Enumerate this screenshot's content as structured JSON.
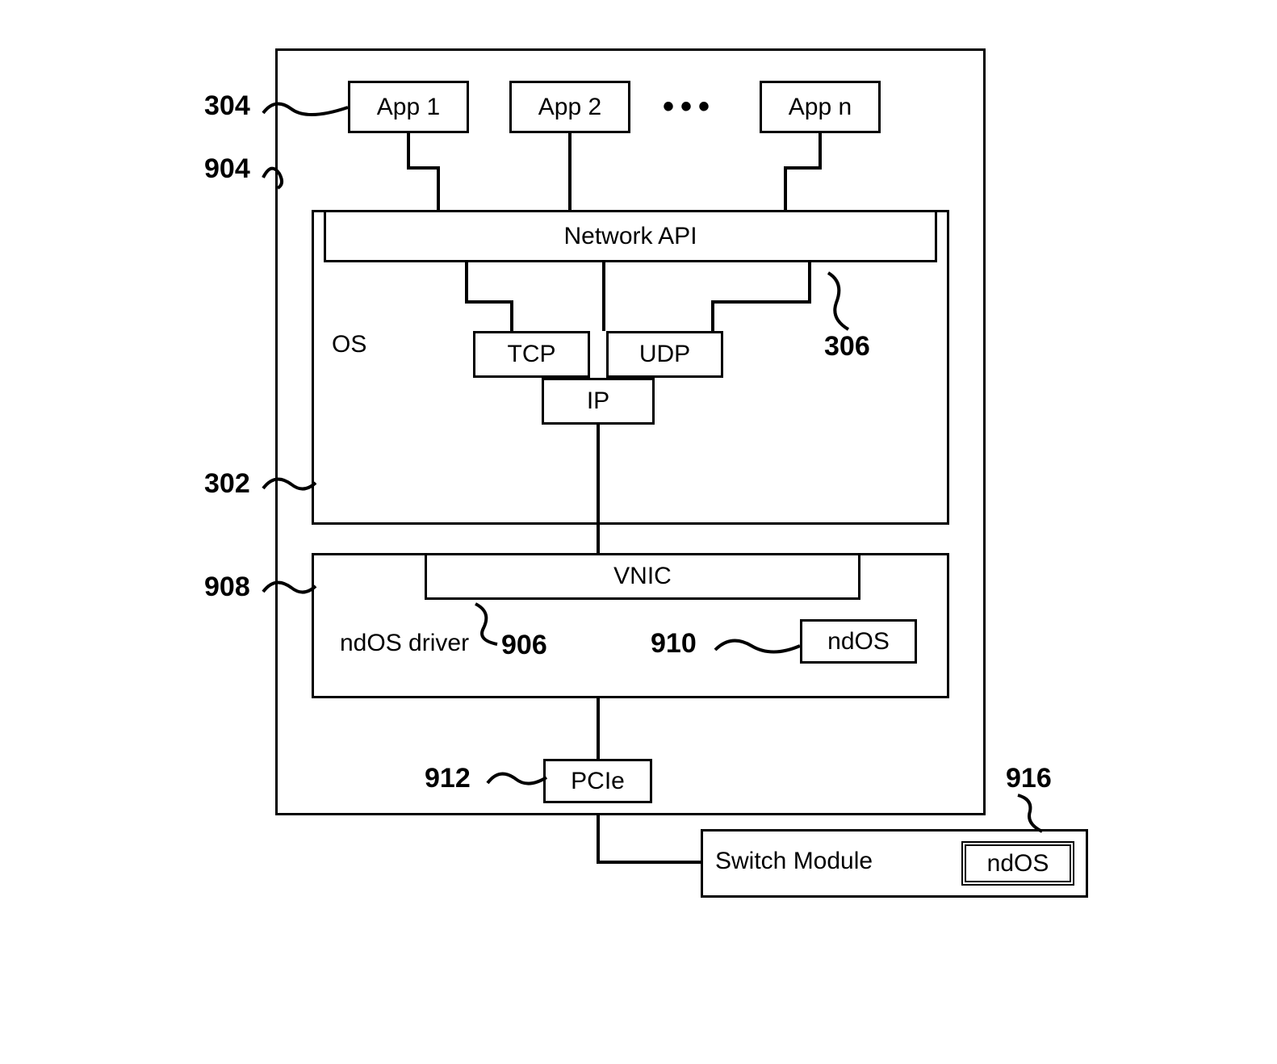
{
  "labels": {
    "l304": "304",
    "l904": "904",
    "l302": "302",
    "l908": "908",
    "l306": "306",
    "l906": "906",
    "l910": "910",
    "l912": "912",
    "l916": "916"
  },
  "boxes": {
    "app1": "App 1",
    "app2": "App 2",
    "appn": "App n",
    "dots": "•••",
    "network_api": "Network API",
    "tcp": "TCP",
    "udp": "UDP",
    "ip": "IP",
    "os": "OS",
    "vnic": "VNIC",
    "ndos_driver": "ndOS driver",
    "ndos_inner": "ndOS",
    "pcie": "PCIe",
    "switch_module": "Switch Module",
    "ndos_switch": "ndOS"
  }
}
